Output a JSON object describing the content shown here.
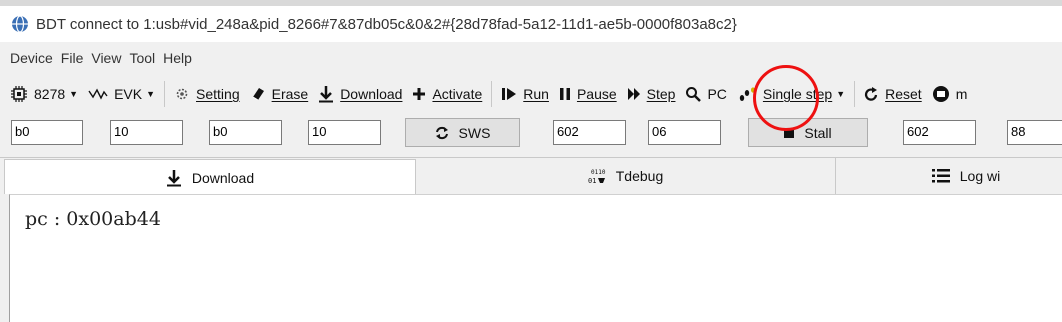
{
  "window": {
    "title": "BDT connect to 1:usb#vid_248a&pid_8266#7&87db05c&0&2#{28d78fad-5a12-11d1-ae5b-0000f803a8c2}",
    "logo_icon": "globe-app-icon"
  },
  "menu": [
    "Device",
    "File",
    "View",
    "Tool",
    "Help"
  ],
  "toolbar": {
    "chip_label": "8278",
    "board_label": "EVK",
    "setting_label": "Setting",
    "erase_label": "Erase",
    "download_label": "Download",
    "activate_label": "Activate",
    "run_label": "Run",
    "pause_label": "Pause",
    "step_label": "Step",
    "pc_label": "PC",
    "single_step_label": "Single step",
    "reset_label": "Reset",
    "more_label": "m"
  },
  "fields": {
    "f1": "b0",
    "f2": "10",
    "f3": "b0",
    "f4": "10",
    "sws_label": "SWS",
    "f5": "602",
    "f6": "06",
    "stall_label": "Stall",
    "f7": "602",
    "f8": "88"
  },
  "tabs": {
    "download": "Download",
    "tdebug": "Tdebug",
    "log": "Log wi"
  },
  "output": {
    "text": "pc : 0x00ab44"
  },
  "colors": {
    "highlight_circle": "#ee1111"
  }
}
